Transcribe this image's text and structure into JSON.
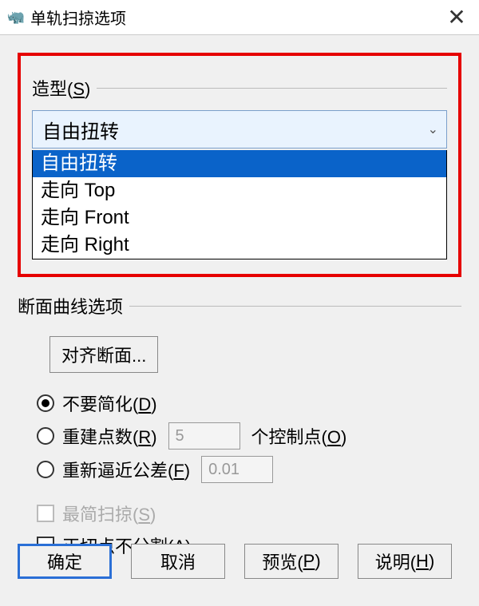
{
  "window": {
    "title": "单轨扫掠选项",
    "close_glyph": "✕",
    "app_icon_glyph": "🦏"
  },
  "style_group": {
    "label_prefix": "造型(",
    "label_key": "S",
    "label_suffix": ")",
    "combo_selected": "自由扭转",
    "chevron": "⌄",
    "options": {
      "o0": "自由扭转",
      "o1": "走向 Top",
      "o2": "走向 Front",
      "o3": "走向 Right"
    }
  },
  "curve_group": {
    "label": "断面曲线选项",
    "align_button": "对齐断面...",
    "r_do_not_simplify_pre": "不要简化(",
    "r_do_not_simplify_key": "D",
    "r_do_not_simplify_suf": ")",
    "r_rebuild_pre": "重建点数(",
    "r_rebuild_key": "R",
    "r_rebuild_suf": ")",
    "rebuild_value": "5",
    "rebuild_tail_pre": "个控制点(",
    "rebuild_tail_key": "O",
    "rebuild_tail_suf": ")",
    "r_refit_pre": "重新逼近公差(",
    "r_refit_key": "F",
    "r_refit_suf": ")",
    "refit_value": "0.01",
    "c_simplest_pre": "最简扫掠(",
    "c_simplest_key": "S",
    "c_simplest_suf": ")",
    "c_tangent_pre": "正切点不分割(",
    "c_tangent_key": "A",
    "c_tangent_suf": ")"
  },
  "buttons": {
    "ok": "确定",
    "cancel": "取消",
    "preview_pre": "预览(",
    "preview_key": "P",
    "preview_suf": ")",
    "help_pre": "说明(",
    "help_key": "H",
    "help_suf": ")"
  }
}
